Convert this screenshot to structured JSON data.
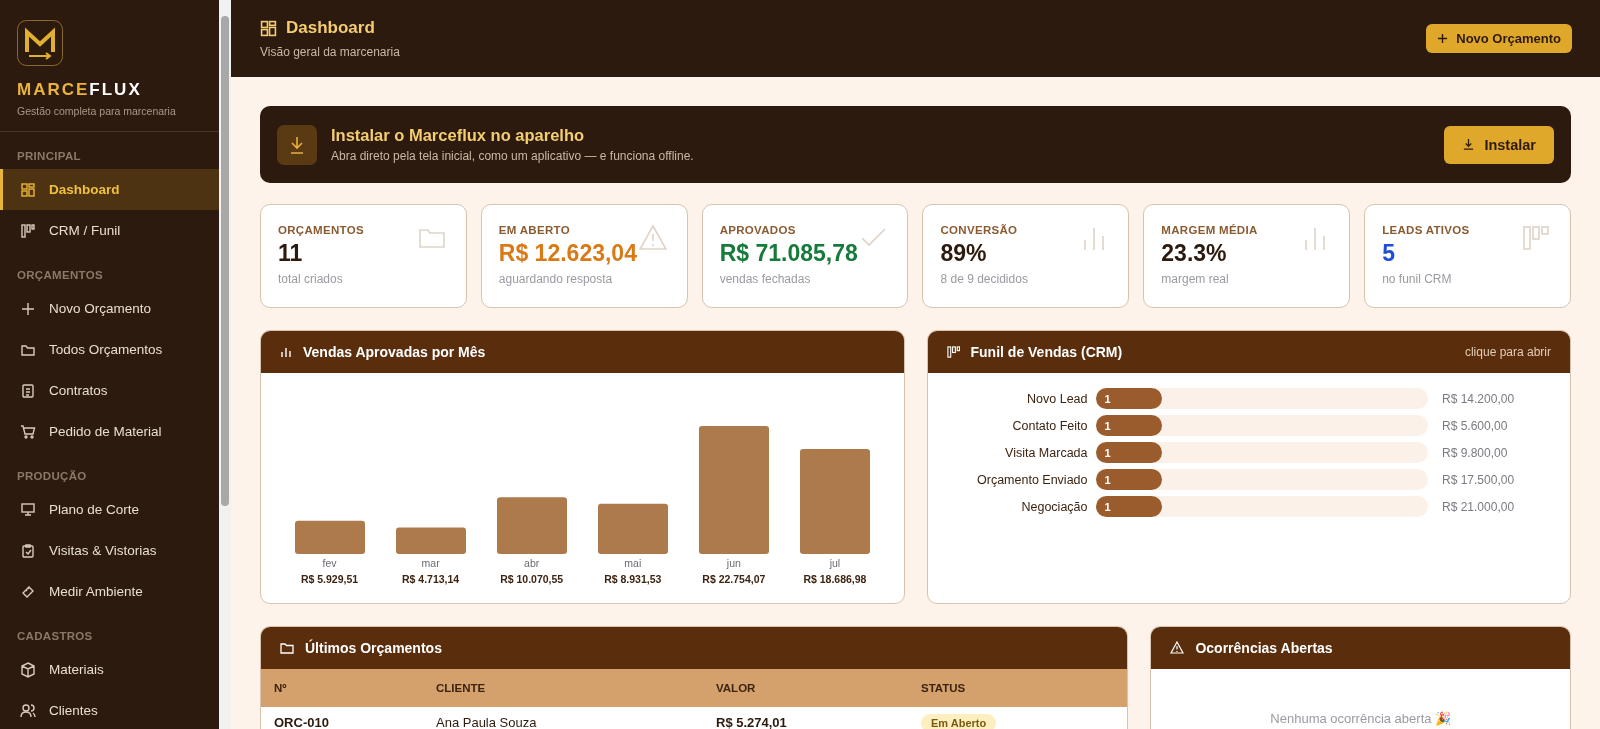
{
  "sidebar": {
    "brand": {
      "first": "MARCE",
      "second": "FLUX"
    },
    "tagline": "Gestão completa para marcenaria",
    "sections": [
      {
        "title": "PRINCIPAL",
        "items": [
          {
            "label": "Dashboard",
            "selected": true
          },
          {
            "label": "CRM / Funil",
            "selected": false
          }
        ]
      },
      {
        "title": "ORÇAMENTOS",
        "items": [
          {
            "label": "Novo Orçamento",
            "selected": false
          },
          {
            "label": "Todos Orçamentos",
            "selected": false
          },
          {
            "label": "Contratos",
            "selected": false
          },
          {
            "label": "Pedido de Material",
            "selected": false
          }
        ]
      },
      {
        "title": "PRODUÇÃO",
        "items": [
          {
            "label": "Plano de Corte",
            "selected": false
          },
          {
            "label": "Visitas & Vistorias",
            "selected": false
          },
          {
            "label": "Medir Ambiente",
            "selected": false
          }
        ]
      },
      {
        "title": "CADASTROS",
        "items": [
          {
            "label": "Materiais",
            "selected": false
          },
          {
            "label": "Clientes",
            "selected": false
          }
        ]
      }
    ]
  },
  "header": {
    "title": "Dashboard",
    "subtitle": "Visão geral da marcenaria",
    "action": "Novo Orçamento"
  },
  "install_banner": {
    "title": "Instalar o Marceflux no aparelho",
    "text": "Abra direto pela tela inicial, como um aplicativo — e funciona offline.",
    "button": "Instalar"
  },
  "kpis": [
    {
      "label": "ORÇAMENTOS",
      "value": "11",
      "caption": "total criados",
      "color": "#2d1a0e"
    },
    {
      "label": "EM ABERTO",
      "value": "R$ 12.623,04",
      "caption": "aguardando resposta",
      "color": "#d97a16"
    },
    {
      "label": "APROVADOS",
      "value": "R$ 71.085,78",
      "caption": "vendas fechadas",
      "color": "#167a3a"
    },
    {
      "label": "CONVERSÃO",
      "value": "89%",
      "caption": "8 de 9 decididos",
      "color": "#2d1a0e"
    },
    {
      "label": "MARGEM MÉDIA",
      "value": "23.3%",
      "caption": "margem real",
      "color": "#2d1a0e"
    },
    {
      "label": "LEADS ATIVOS",
      "value": "5",
      "caption": "no funil CRM",
      "color": "#1d4ed8"
    }
  ],
  "sales_panel": {
    "title": "Vendas Aprovadas por Mês",
    "chart_data": {
      "type": "bar",
      "categories": [
        "fev",
        "mar",
        "abr",
        "mai",
        "jun",
        "jul"
      ],
      "series": [
        {
          "color": "#ad7a4c",
          "values": [
            5929.51,
            4713.14,
            10070.55,
            8931.53,
            22754.07,
            18686.98
          ],
          "value_labels": [
            "R$ 5.929,51",
            "R$ 4.713,14",
            "R$ 10.070,55",
            "R$ 8.931,53",
            "R$ 22.754,07",
            "R$ 18.686,98"
          ]
        }
      ]
    }
  },
  "funnel_panel": {
    "title": "Funil de Vendas (CRM)",
    "hint": "clique para abrir",
    "stages": [
      {
        "name": "Novo Lead",
        "count": "1",
        "level": 0.2,
        "amount": "R$ 14.200,00"
      },
      {
        "name": "Contato Feito",
        "count": "1",
        "level": 0.2,
        "amount": "R$ 5.600,00"
      },
      {
        "name": "Visita Marcada",
        "count": "1",
        "level": 0.2,
        "amount": "R$ 9.800,00"
      },
      {
        "name": "Orçamento Enviado",
        "count": "1",
        "level": 0.2,
        "amount": "R$ 17.500,00"
      },
      {
        "name": "Negociação",
        "count": "1",
        "level": 0.2,
        "amount": "R$ 21.000,00"
      }
    ]
  },
  "quotes_panel": {
    "title": "Últimos Orçamentos",
    "columns": [
      "Nº",
      "CLIENTE",
      "VALOR",
      "STATUS"
    ],
    "rows": [
      {
        "number": "ORC-010",
        "client": "Ana Paula Souza",
        "value": "R$ 5.274,01",
        "status": "Em Aberto"
      }
    ]
  },
  "issues_panel": {
    "title": "Ocorrências Abertas",
    "empty": "Nenhuma ocorrência aberta 🎉"
  }
}
